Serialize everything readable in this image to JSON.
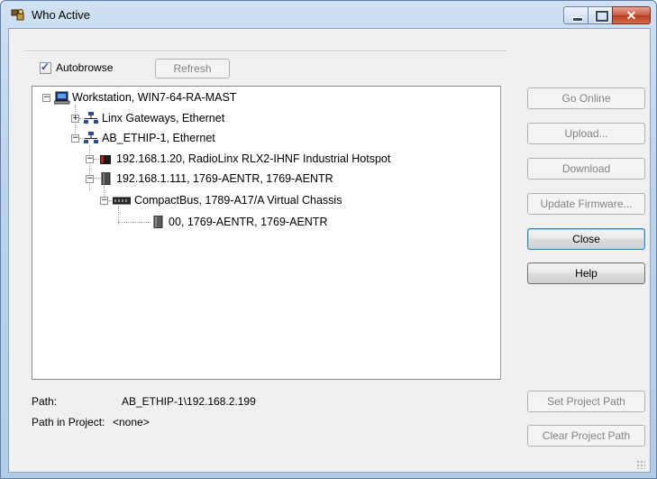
{
  "window": {
    "title": "Who Active"
  },
  "toolbar": {
    "autobrowse_label": "Autobrowse",
    "autobrowse_checked": true,
    "refresh_label": "Refresh"
  },
  "tree": {
    "workstation": "Workstation, WIN7-64-RA-MAST",
    "linx_gateways": "Linx Gateways, Ethernet",
    "ab_ethip": "AB_ETHIP-1, Ethernet",
    "device_1": "192.168.1.20, RadioLinx RLX2-IHNF Industrial Hotspot",
    "device_2": "192.168.1.111, 1769-AENTR, 1769-AENTR",
    "compactbus": "CompactBus, 1789-A17/A Virtual Chassis",
    "slot_00": "00, 1769-AENTR, 1769-AENTR"
  },
  "buttons": {
    "go_online": "Go Online",
    "upload": "Upload...",
    "download": "Download",
    "update_firmware": "Update Firmware...",
    "close": "Close",
    "help": "Help",
    "set_project_path": "Set Project Path",
    "clear_project_path": "Clear Project Path"
  },
  "footer": {
    "path_label": "Path:",
    "path_value": "AB_ETHIP-1\\192.168.2.199",
    "project_path_label": "Path in Project:",
    "project_path_value": "<none>"
  },
  "colors": {
    "frame": "#bcd3ec",
    "close_button": "#c95a3f",
    "default_button_border": "#3c7fb1"
  }
}
